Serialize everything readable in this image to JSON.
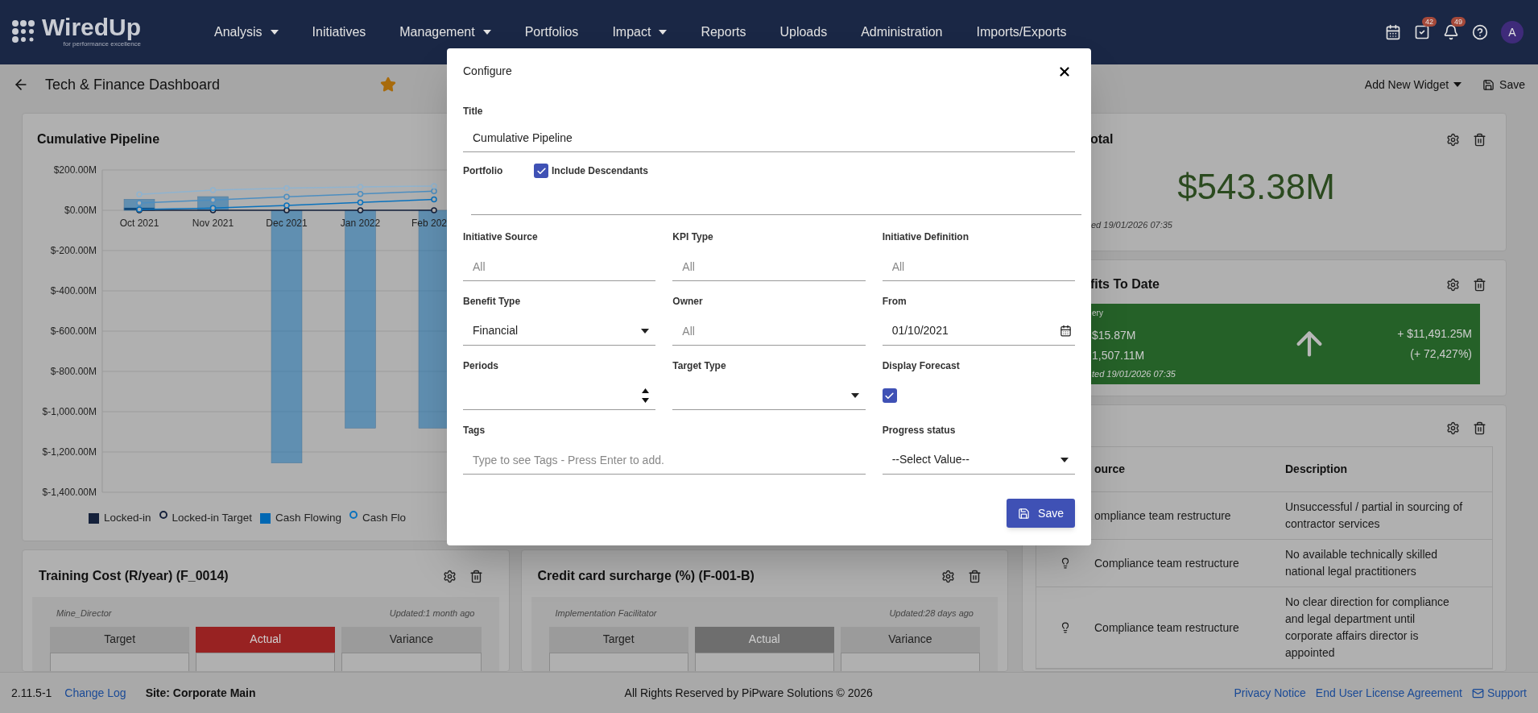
{
  "nav": {
    "logo": "WiredUp",
    "tagline": "for performance excellence",
    "items": [
      {
        "label": "Analysis",
        "dropdown": true
      },
      {
        "label": "Initiatives",
        "dropdown": false
      },
      {
        "label": "Management",
        "dropdown": true
      },
      {
        "label": "Portfolios",
        "dropdown": false
      },
      {
        "label": "Impact",
        "dropdown": true
      },
      {
        "label": "Reports",
        "dropdown": false
      },
      {
        "label": "Uploads",
        "dropdown": false
      },
      {
        "label": "Administration",
        "dropdown": false
      },
      {
        "label": "Imports/Exports",
        "dropdown": false
      }
    ],
    "tools": [
      {
        "kind": "calendar"
      },
      {
        "kind": "tasks",
        "badge": "42"
      },
      {
        "kind": "bell",
        "badge": "49"
      },
      {
        "kind": "help"
      }
    ],
    "avatar": "A"
  },
  "toolbar": {
    "title": "Tech & Finance Dashboard",
    "favorite": true,
    "add_widget": "Add New Widget",
    "save": "Save"
  },
  "chart_card": {
    "title": "Cumulative Pipeline",
    "chart_data": {
      "type": "bar",
      "grid": true,
      "categories": [
        "Oct 2021",
        "Nov 2021",
        "Dec 2021",
        "Jan 2022",
        "Feb 202"
      ],
      "ylim": [
        -1400,
        200
      ],
      "yticks": [
        {
          "value": 200,
          "label": "$200.00M"
        },
        {
          "value": 0,
          "label": "$0.00M"
        },
        {
          "value": -200,
          "label": "$-200.00M"
        },
        {
          "value": -400,
          "label": "$-400.00M"
        },
        {
          "value": -600,
          "label": "$-600.00M"
        },
        {
          "value": -800,
          "label": "$-800.00M"
        },
        {
          "value": -1000,
          "label": "$-1,000.00M"
        },
        {
          "value": -1200,
          "label": "$-1,200.00M"
        },
        {
          "value": -1400,
          "label": "$-1,400.00M"
        }
      ],
      "series": [
        {
          "name": "Locked-in",
          "type": "bar",
          "color": "#15213b",
          "values": [
            12,
            null,
            null,
            null,
            null
          ]
        },
        {
          "name": "Locked-in Target",
          "type": "line",
          "marker": "circle",
          "color": "#15213b",
          "values": [
            0,
            0,
            0,
            0,
            0
          ]
        },
        {
          "name": "Cash Flowing",
          "type": "bar",
          "color": "#0068b3",
          "values": [
            55,
            68,
            -1255,
            -1082,
            -1082
          ]
        },
        {
          "name": "Cash Flo",
          "type": "line",
          "marker": "circle",
          "color": "#0a72bd",
          "values": [
            4,
            11,
            24,
            39,
            54
          ]
        },
        {
          "type": "line",
          "marker": "circle",
          "color": "#4d8ec0",
          "values": [
            36,
            51,
            67,
            81,
            95
          ]
        },
        {
          "type": "line",
          "marker": "circle",
          "color": "#8fb3cf",
          "values": [
            79,
            100,
            110,
            116,
            120
          ]
        }
      ]
    }
  },
  "metric_cards": [
    {
      "title": "Training Cost (R/year) (F_0014)",
      "owner": "Mine_Director",
      "updated": "Updated:1 month ago",
      "columns": [
        {
          "label": "Target",
          "color": "#9b9b9b"
        },
        {
          "label": "Actual",
          "color": "#982222"
        },
        {
          "label": "Variance",
          "color": "#9b9b9b"
        }
      ]
    },
    {
      "title": "Credit card surcharge (%) (F-001-B)",
      "owner": "Implementation Facilitator",
      "updated": "Updated:28 days ago",
      "columns": [
        {
          "label": "Target",
          "color": "#9b9b9b"
        },
        {
          "label": "Actual",
          "color": "#6e6e6e"
        },
        {
          "label": "Variance",
          "color": "#9b9b9b"
        }
      ]
    }
  ],
  "total_card": {
    "title": "otal",
    "value": "$543.38M",
    "updated": "ed 19/01/2026 07:35"
  },
  "benefits_card": {
    "title": "fits To Date",
    "tile": {
      "caption": "ery",
      "line_1": "$15.87M",
      "line_2": "1,507.11M",
      "updated": "ted 19/01/2026 07:35",
      "change": "+ $11,491.25M",
      "percent": "(+ 72,427%)",
      "up": true
    }
  },
  "table_card": {
    "columns": [
      "ource",
      "Description"
    ],
    "rows": [
      {
        "icon": false,
        "source": "ompliance team restructure",
        "description": "Unsuccessful / partial in sourcing of contractor services"
      },
      {
        "icon": true,
        "source": "Compliance team restructure",
        "description": "No available technically skilled national legal practitioners"
      },
      {
        "icon": true,
        "source": "Compliance team restructure",
        "description": "No clear direction for compliance and legal department until corporate affairs director is appointed"
      }
    ]
  },
  "modal": {
    "title": "Configure",
    "title_field": {
      "label": "Title",
      "value": "Cumulative Pipeline"
    },
    "portfolio": {
      "label": "Portfolio",
      "include_descendants": {
        "label": "Include Descendants",
        "checked": true
      }
    },
    "fields": [
      {
        "kind": "text",
        "label": "Initiative Source",
        "placeholder": "All"
      },
      {
        "kind": "text",
        "label": "KPI Type",
        "placeholder": "All"
      },
      {
        "kind": "text",
        "label": "Initiative Definition",
        "placeholder": "All"
      },
      {
        "kind": "select",
        "label": "Benefit Type",
        "value": "Financial"
      },
      {
        "kind": "text",
        "label": "Owner",
        "placeholder": "All"
      },
      {
        "kind": "date",
        "label": "From",
        "value": "01/10/2021"
      },
      {
        "kind": "number",
        "label": "Periods"
      },
      {
        "kind": "select",
        "label": "Target Type"
      },
      {
        "kind": "checkbox",
        "label": "Display Forecast",
        "checked": true
      },
      {
        "kind": "tags",
        "label": "Tags",
        "placeholder": "Type to see Tags - Press Enter to add."
      },
      {
        "kind": "select",
        "label": "Progress status",
        "value": "--Select Value--"
      }
    ],
    "save": "Save"
  },
  "footer": {
    "version": "2.11.5-1",
    "change_log": "Change Log",
    "site": "Site: Corporate Main",
    "copyright": "All Rights Reserved by PiPware Solutions © 2026",
    "links": [
      "Privacy Notice",
      "End User License Agreement"
    ],
    "support": "Support"
  }
}
